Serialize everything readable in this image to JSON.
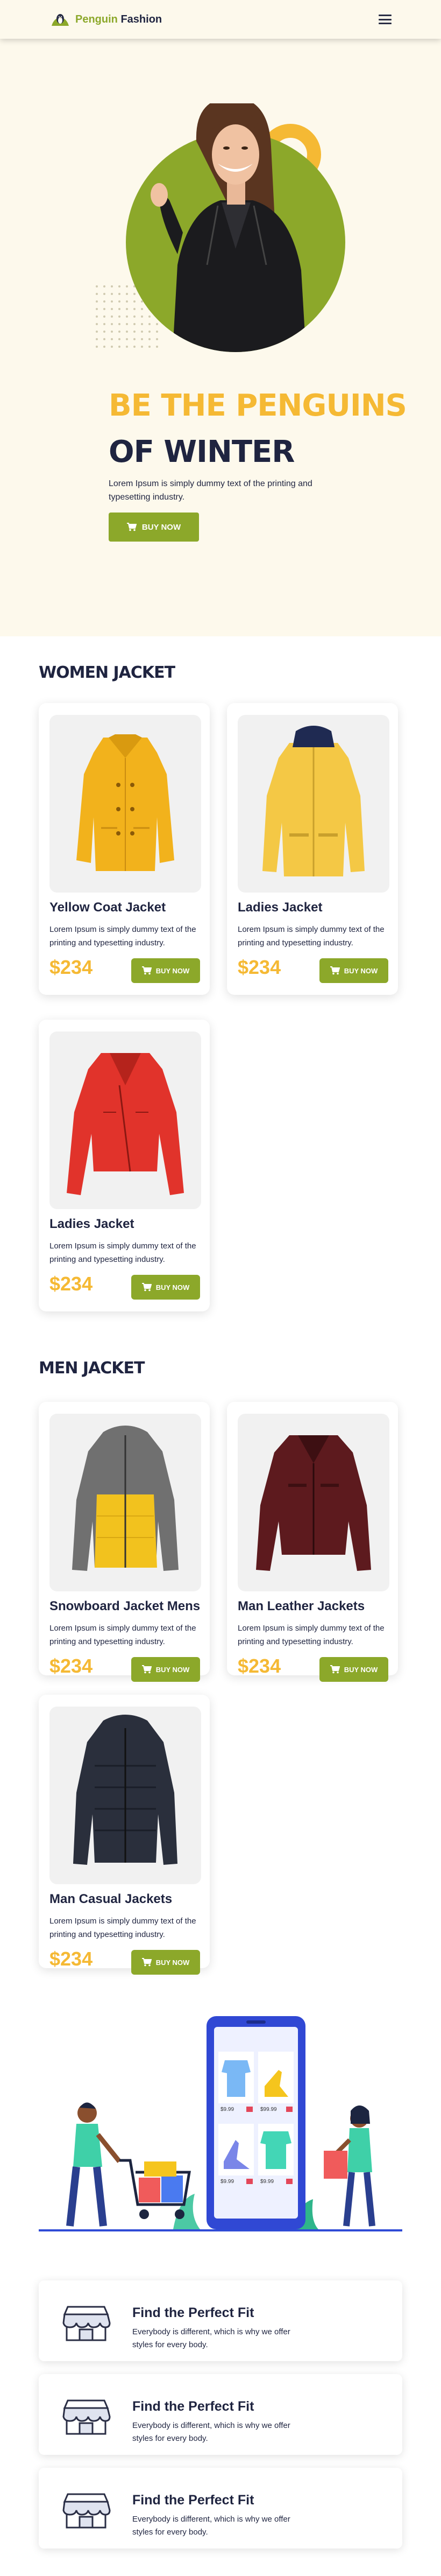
{
  "header": {
    "brand_part1": "Penguin",
    "brand_part2": "Fashion"
  },
  "hero": {
    "title_line1": "BE THE PENGUINS",
    "title_line2": "OF WINTER",
    "description": "Lorem Ipsum is simply dummy text of the printing and typesetting industry.",
    "cta_label": "BUY NOW"
  },
  "women": {
    "section_title": "WOMEN JACKET",
    "products": [
      {
        "name": "Yellow Coat Jacket",
        "desc": "Lorem Ipsum is simply dummy text of the printing and typesetting industry.",
        "price": "$234",
        "buy": "BUY NOW"
      },
      {
        "name": "Ladies Jacket",
        "desc": "Lorem Ipsum is simply dummy text of the printing and typesetting industry.",
        "price": "$234",
        "buy": "BUY NOW"
      },
      {
        "name": "Ladies Jacket",
        "desc": "Lorem Ipsum is simply dummy text of the printing and typesetting industry.",
        "price": "$234",
        "buy": "BUY NOW"
      }
    ]
  },
  "men": {
    "section_title": "MEN JACKET",
    "products": [
      {
        "name": "Snowboard Jacket Mens",
        "desc": "Lorem Ipsum is simply dummy text of the printing and typesetting industry.",
        "price": "$234",
        "buy": "BUY NOW"
      },
      {
        "name": "Man Leather Jackets",
        "desc": "Lorem Ipsum is simply dummy text of the printing and typesetting industry.",
        "price": "$234",
        "buy": "BUY NOW"
      },
      {
        "name": "Man Casual Jackets",
        "desc": "Lorem Ipsum is simply dummy text of the printing and typesetting industry.",
        "price": "$234",
        "buy": "BUY NOW"
      }
    ]
  },
  "illustration": {
    "prices": [
      "$9.99",
      "$99.99",
      "$9.99",
      "$9.99"
    ]
  },
  "features": [
    {
      "title": "Find the Perfect Fit",
      "desc": "Everybody is different, which is why we offer styles for every body.",
      "icon": "storefront-icon"
    },
    {
      "title": "Find the Perfect Fit",
      "desc": "Everybody is different, which is why we offer styles for every body.",
      "icon": "storefront-icon"
    },
    {
      "title": "Find the Perfect Fit",
      "desc": "Everybody is different, which is why we offer styles for every body.",
      "icon": "storefront-icon"
    }
  ],
  "colors": {
    "accent_green": "#8ca82a",
    "accent_yellow": "#f5b934",
    "navy": "#1f2440",
    "cream": "#fdf9ec"
  }
}
